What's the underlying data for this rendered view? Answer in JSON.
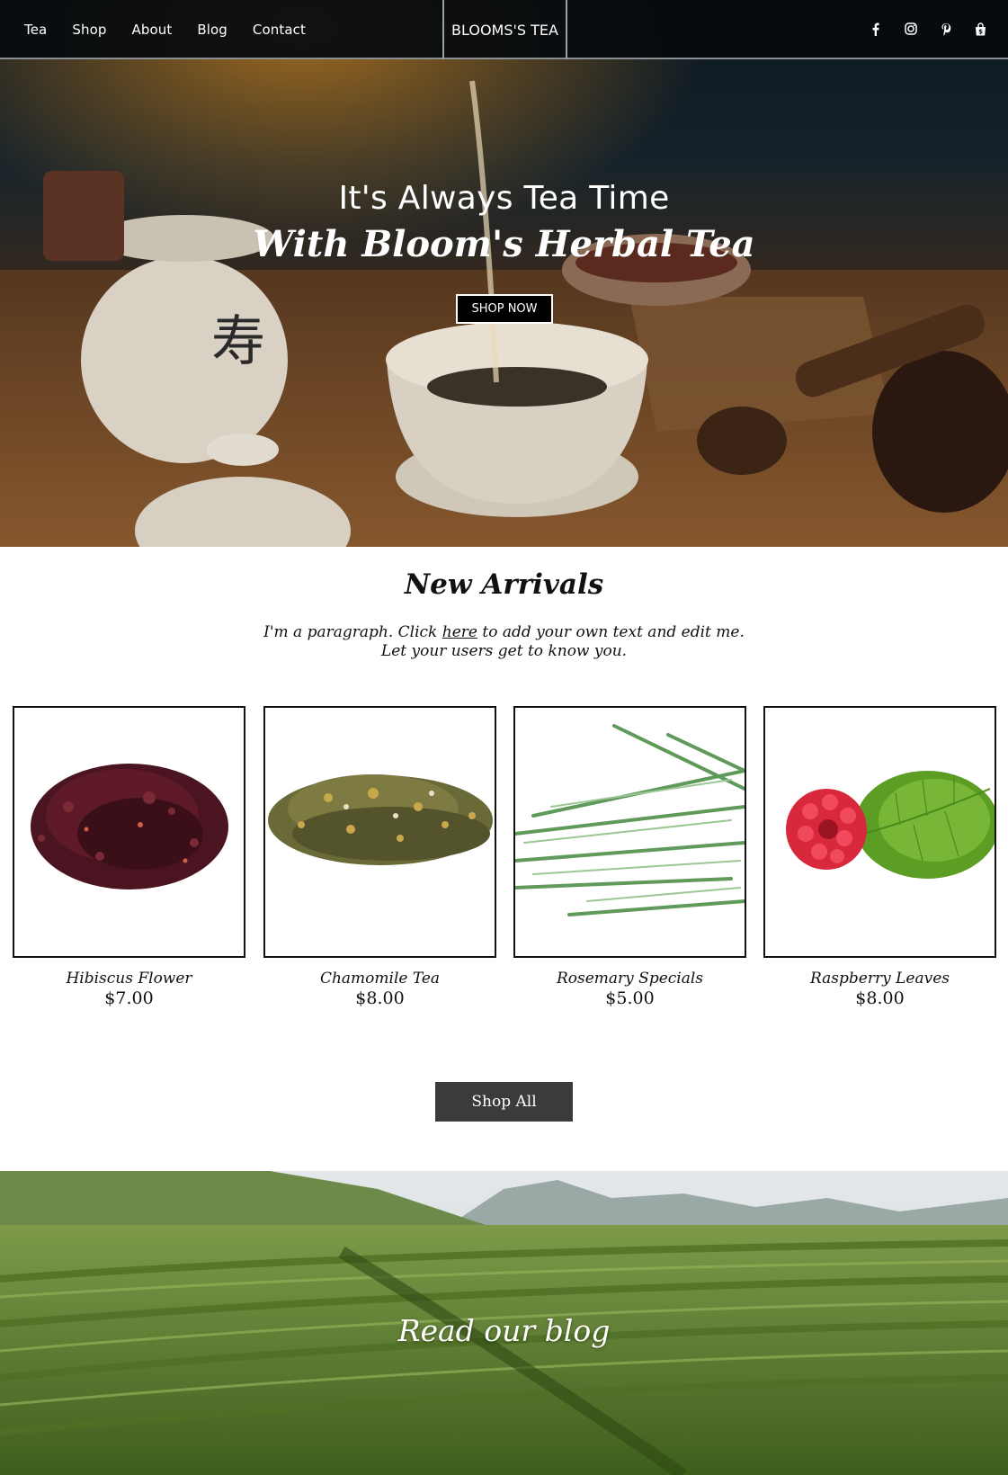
{
  "nav": {
    "links": [
      "Tea",
      "Shop",
      "About",
      "Blog",
      "Contact"
    ],
    "brand": "BLOOMS'S TEA",
    "social_icons": [
      "facebook-icon",
      "instagram-icon",
      "pinterest-icon",
      "shopping-bag-icon"
    ]
  },
  "hero": {
    "line1": "It's Always Tea Time",
    "line2": "With Bloom's Herbal Tea",
    "cta": "SHOP NOW"
  },
  "arrivals": {
    "title": "New Arrivals",
    "intro_before": "I'm a paragraph. Click ",
    "intro_link": "here",
    "intro_after": " to add your own text and edit me. Let your users get to know you.",
    "products": [
      {
        "name": "Hibiscus Flower",
        "price": "$7.00"
      },
      {
        "name": "Chamomile Tea",
        "price": "$8.00"
      },
      {
        "name": "Rosemary Specials",
        "price": "$5.00"
      },
      {
        "name": "Raspberry Leaves",
        "price": "$8.00"
      }
    ],
    "shop_all": "Shop All"
  },
  "blog": {
    "title": "Read our blog"
  },
  "colors": {
    "nav_bg": "#050a0e",
    "button_dark": "#3b3b3b",
    "text": "#111111"
  }
}
